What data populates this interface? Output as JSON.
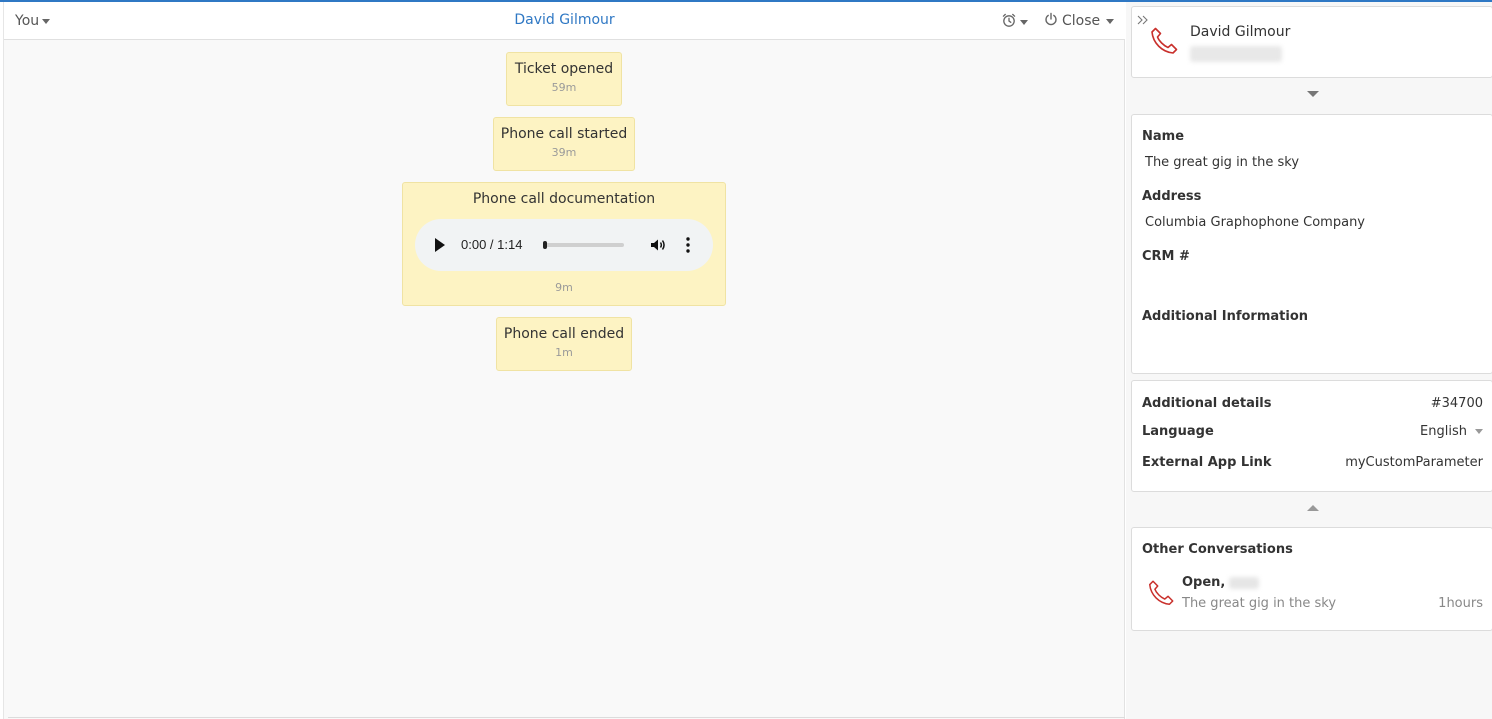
{
  "header": {
    "user_menu_label": "You",
    "title": "David Gilmour",
    "close_label": "Close"
  },
  "timeline": {
    "events": [
      {
        "label": "Ticket opened",
        "time": "59m"
      },
      {
        "label": "Phone call started",
        "time": "39m"
      },
      {
        "label": "Phone call documentation",
        "time": "9m"
      },
      {
        "label": "Phone call ended",
        "time": "1m"
      }
    ],
    "audio": {
      "time_display": "0:00 / 1:14",
      "progress": 0
    }
  },
  "contact": {
    "name": "David Gilmour"
  },
  "fields": {
    "name_label": "Name",
    "name_value": "The great gig in the sky",
    "address_label": "Address",
    "address_value": "Columbia Graphophone Company",
    "crm_label": "CRM #",
    "crm_value": "",
    "additional_info_label": "Additional Information",
    "additional_info_value": ""
  },
  "details": {
    "title": "Additional details",
    "ticket_id": "#34700",
    "language_label": "Language",
    "language_value": "English",
    "external_link_label": "External App Link",
    "external_link_value": "myCustomParameter"
  },
  "other_conversations": {
    "title": "Other Conversations",
    "items": [
      {
        "status": "Open,",
        "subject": "The great gig in the sky",
        "age": "1hours"
      }
    ]
  },
  "icons": {
    "phone": "phone-icon",
    "alarm": "alarm-clock-icon",
    "power": "power-icon",
    "expand": "double-chevron-right-icon"
  },
  "colors": {
    "accent": "#2f78c4",
    "event_bg": "#fdf3c3",
    "phone_icon": "#c9302c"
  }
}
